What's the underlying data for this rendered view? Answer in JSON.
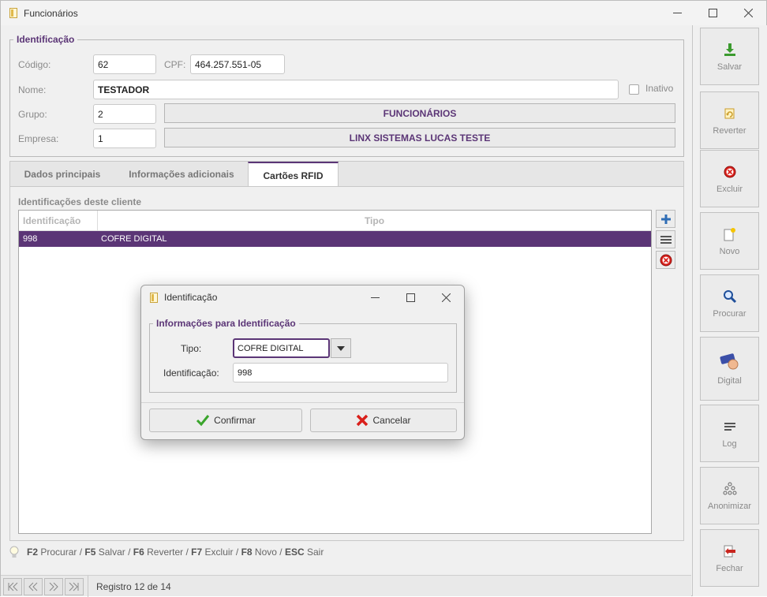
{
  "window": {
    "title": "Funcionários",
    "minimize": "—",
    "maximize": "☐",
    "close": "✕"
  },
  "identificacao": {
    "legend": "Identificação",
    "codigo_label": "Código:",
    "codigo_value": "62",
    "cpf_label": "CPF:",
    "cpf_value": "464.257.551-05",
    "nome_label": "Nome:",
    "nome_value": "TESTADOR",
    "inativo_label": "Inativo",
    "grupo_label": "Grupo:",
    "grupo_value": "2",
    "grupo_desc": "FUNCIONÁRIOS",
    "empresa_label": "Empresa:",
    "empresa_value": "1",
    "empresa_desc": "LINX SISTEMAS LUCAS TESTE"
  },
  "tabs": [
    {
      "label": "Dados principais"
    },
    {
      "label": "Informações adicionais"
    },
    {
      "label": "Cartões RFID"
    }
  ],
  "rfid": {
    "section_label": "Identificações deste cliente",
    "columns": [
      "Identificação",
      "Tipo"
    ],
    "rows": [
      {
        "identificacao": "998",
        "tipo": "COFRE DIGITAL"
      }
    ]
  },
  "hint": {
    "f2": "F2",
    "procurar": "Procurar /",
    "f5": "F5",
    "salvar": "Salvar /",
    "f6": "F6",
    "reverter": "Reverter /",
    "f7": "F7",
    "excluir": "Excluir /",
    "f8": "F8",
    "novo": "Novo /",
    "esc": "ESC",
    "sair": "Sair"
  },
  "status": {
    "text": "Registro 12 de 14"
  },
  "sidebar": [
    {
      "label": "Salvar",
      "icon": "save-icon"
    },
    {
      "label": "Reverter",
      "icon": "revert-icon"
    },
    {
      "label": "Excluir",
      "icon": "delete-icon"
    },
    {
      "label": "Novo",
      "icon": "new-icon"
    },
    {
      "label": "Procurar",
      "icon": "search-icon"
    },
    {
      "label": "Digital",
      "icon": "fingerprint-icon"
    },
    {
      "label": "Log",
      "icon": "log-icon"
    },
    {
      "label": "Anonimizar",
      "icon": "anonymize-icon"
    },
    {
      "label": "Fechar",
      "icon": "exit-icon"
    }
  ],
  "dialog": {
    "title": "Identificação",
    "legend": "Informações para Identificação",
    "tipo_label": "Tipo:",
    "tipo_value": "COFRE DIGITAL",
    "ident_label": "Identificação:",
    "ident_value": "998",
    "confirm_label": "Confirmar",
    "cancel_label": "Cancelar"
  },
  "colors": {
    "accent": "#5b3576"
  }
}
